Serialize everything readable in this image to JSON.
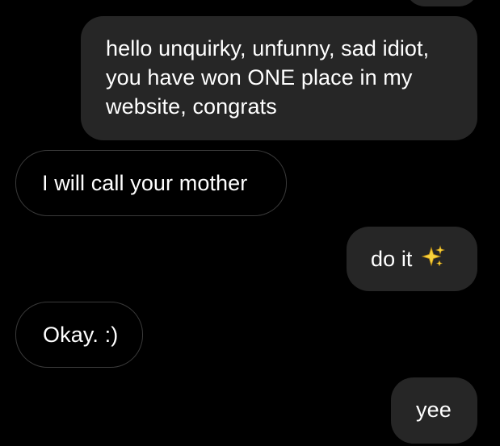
{
  "conversation": {
    "messages": [
      {
        "direction": "sent",
        "text": "hello unquirky, unfunny, sad idiot, you have won ONE place in my website, congrats"
      },
      {
        "direction": "received",
        "text": "I will call your mother"
      },
      {
        "direction": "sent",
        "text": "do it",
        "emoji_icon": "sparkles-icon"
      },
      {
        "direction": "received",
        "text": "Okay. :)"
      },
      {
        "direction": "sent",
        "text": "yee"
      }
    ]
  },
  "colors": {
    "background": "#000000",
    "sent_bubble": "#262626",
    "received_border": "#3a3a3a",
    "text": "#ffffff",
    "sparkle": "#f7d13c"
  }
}
